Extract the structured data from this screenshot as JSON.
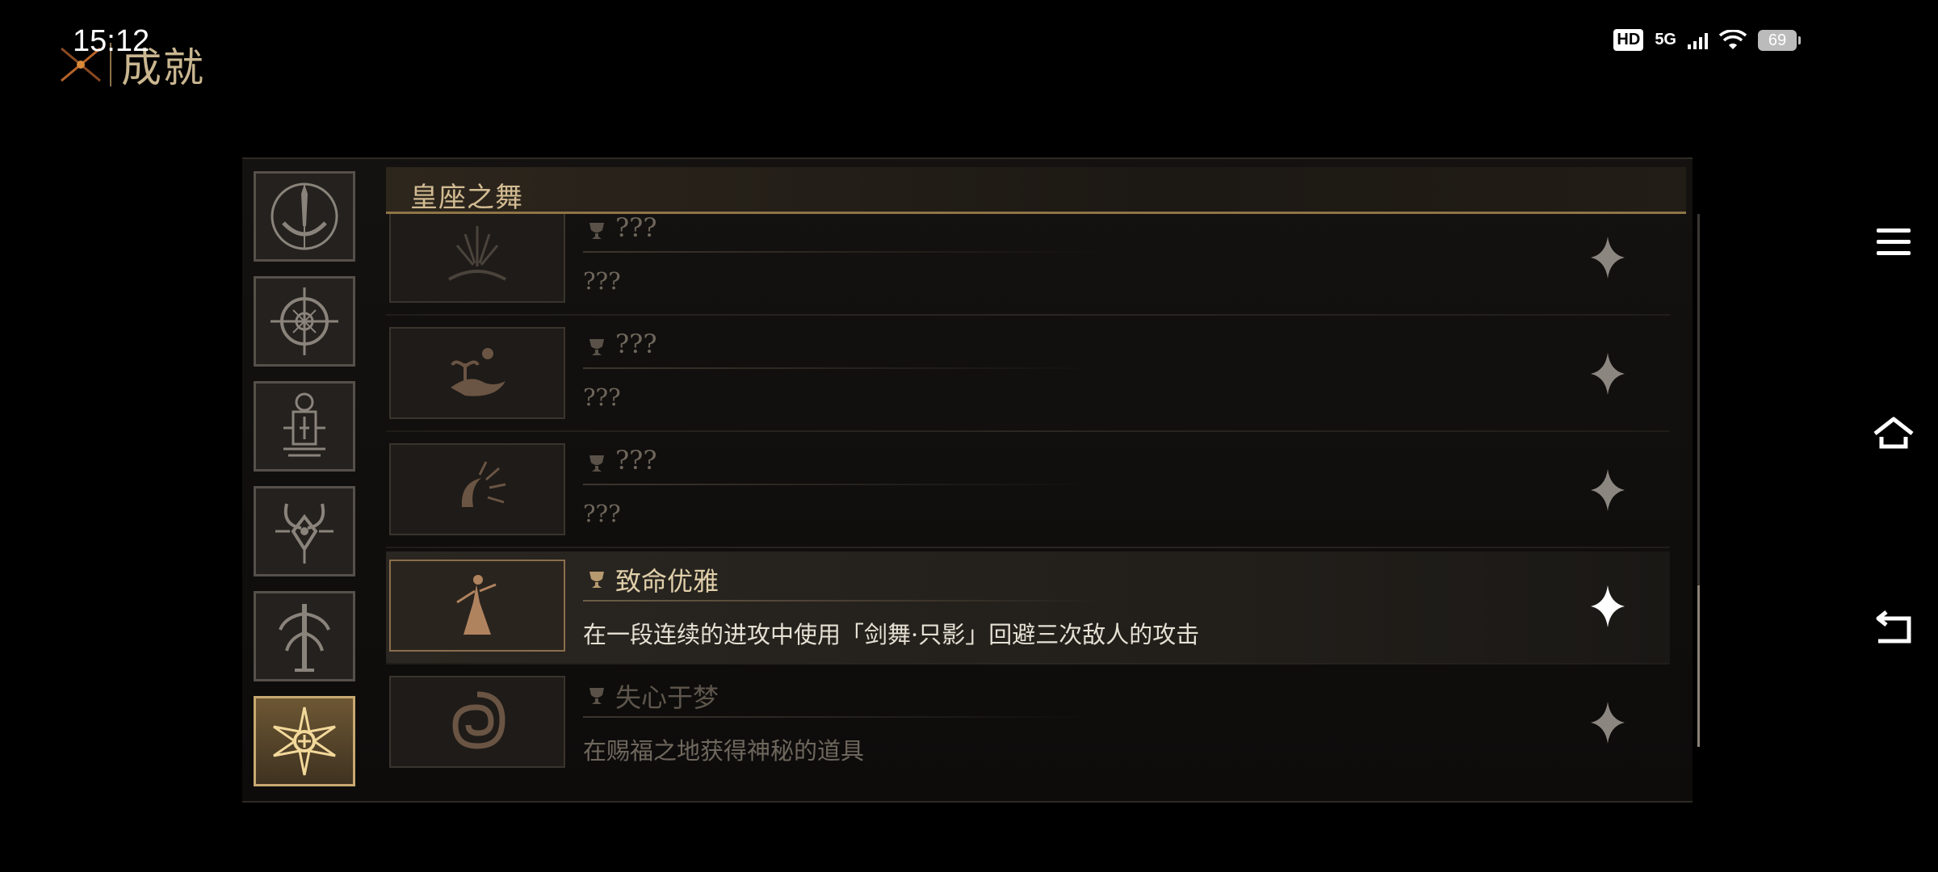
{
  "status_bar": {
    "time": "15:12",
    "hd": "HD",
    "network": "5G",
    "battery": "69"
  },
  "game": {
    "title": "成就"
  },
  "panel": {
    "section_title": "皇座之舞",
    "tabs": [
      {
        "icon": "crescent-spire-icon",
        "active": false
      },
      {
        "icon": "compass-eye-icon",
        "active": false
      },
      {
        "icon": "lantern-key-icon",
        "active": false
      },
      {
        "icon": "horned-sigil-icon",
        "active": false
      },
      {
        "icon": "tree-totem-icon",
        "active": false
      },
      {
        "icon": "radiant-sun-icon",
        "active": true
      }
    ],
    "achievements": [
      {
        "title": "???",
        "description": "???",
        "icon": "sunburst-mountain-icon",
        "state": "locked"
      },
      {
        "title": "???",
        "description": "???",
        "icon": "island-tree-icon",
        "state": "locked"
      },
      {
        "title": "???",
        "description": "???",
        "icon": "eclipse-sun-icon",
        "state": "locked"
      },
      {
        "title": "致命优雅",
        "description": "在一段连续的进攻中使用「剑舞·只影」回避三次敌人的攻击",
        "icon": "dancer-figure-icon",
        "state": "highlighted"
      },
      {
        "title": "失心于梦",
        "description": "在赐福之地获得神秘的道具",
        "icon": "swirl-dream-icon",
        "state": "dim"
      }
    ]
  },
  "colors": {
    "accent_gold": "#c7a970",
    "panel_bg": "#141210",
    "text_highlight": "#e6e0d4",
    "text_locked": "#6f665b"
  }
}
